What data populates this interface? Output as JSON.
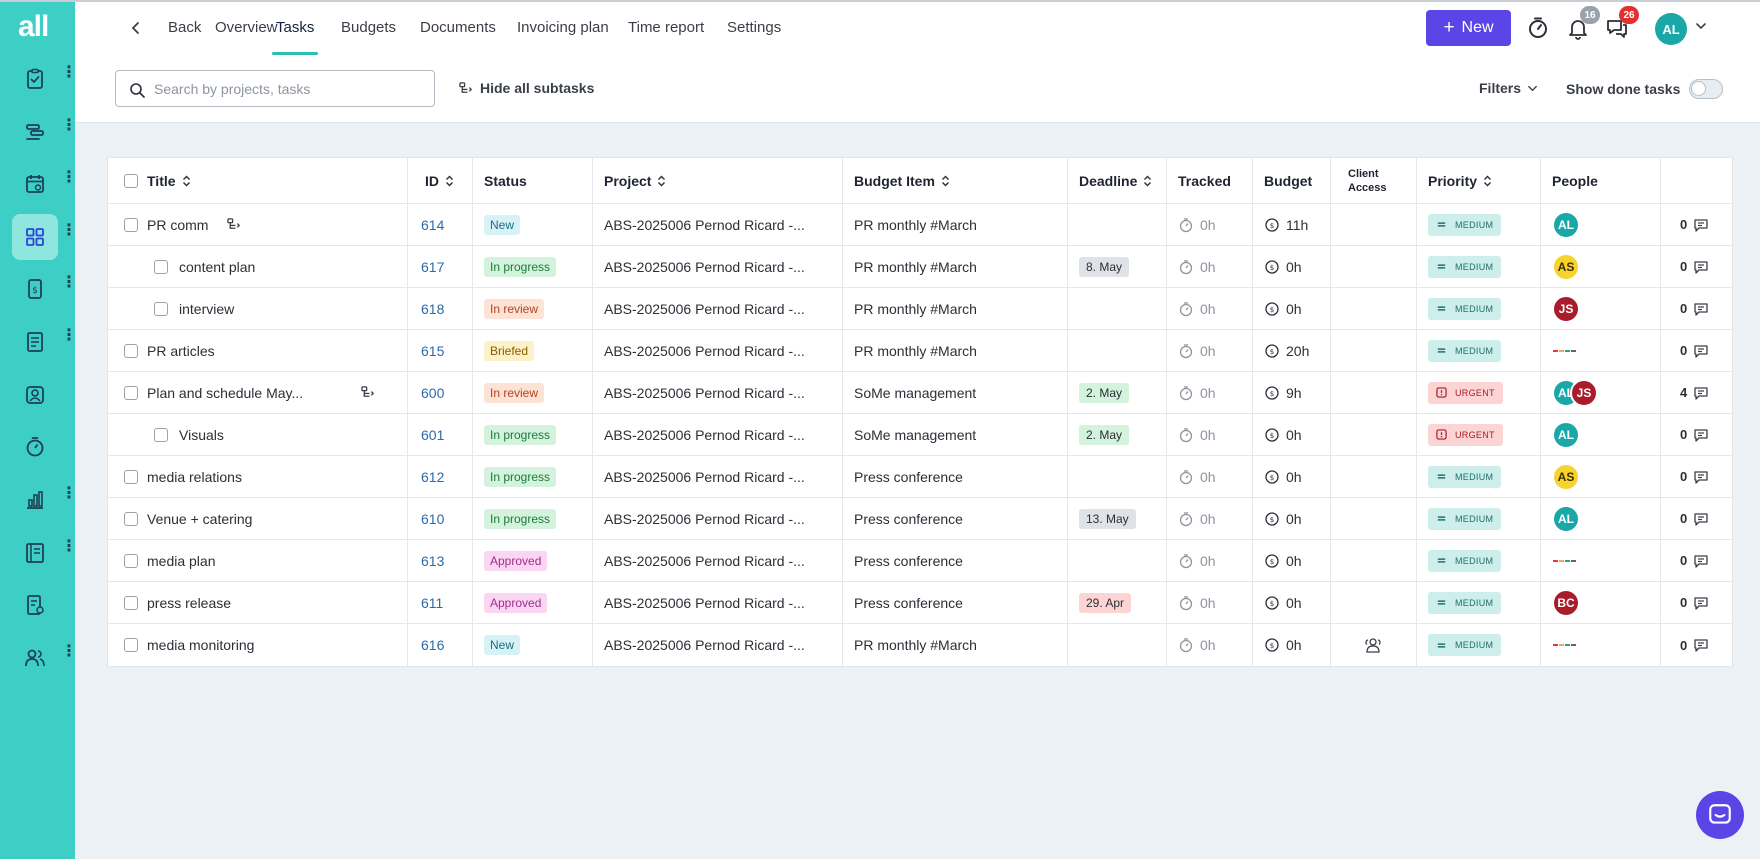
{
  "app": {
    "logo": "all"
  },
  "nav": {
    "back": "Back",
    "tabs": [
      "Overview",
      "Tasks",
      "Budgets",
      "Documents",
      "Invoicing plan",
      "Time report",
      "Settings"
    ],
    "active_tab": "Tasks",
    "new_label": "New",
    "notifications_count": "16",
    "messages_count": "26",
    "user_initials": "AL"
  },
  "toolbar": {
    "search_placeholder": "Search by projects, tasks",
    "hide_subtasks": "Hide all subtasks",
    "filters": "Filters",
    "show_done": "Show done tasks",
    "show_done_on": false
  },
  "table": {
    "headers": {
      "title": "Title",
      "id": "ID",
      "status": "Status",
      "project": "Project",
      "budget_item": "Budget Item",
      "deadline": "Deadline",
      "tracked": "Tracked",
      "budget": "Budget",
      "client_access": "Client Access",
      "priority": "Priority",
      "people": "People"
    },
    "rows": [
      {
        "title": "PR comm",
        "id": "614",
        "status": "New",
        "project": "ABS-2025006 Pernod Ricard -...",
        "budget_item": "PR monthly #March",
        "deadline": "",
        "tracked": "0h",
        "budget": "11h",
        "priority": "MEDIUM",
        "people": [
          "AL"
        ],
        "comments": "0"
      },
      {
        "title": "content plan",
        "id": "617",
        "status": "In progress",
        "project": "ABS-2025006 Pernod Ricard -...",
        "budget_item": "PR monthly #March",
        "deadline": "8. May",
        "tracked": "0h",
        "budget": "0h",
        "priority": "MEDIUM",
        "people": [
          "AS"
        ],
        "comments": "0"
      },
      {
        "title": "interview",
        "id": "618",
        "status": "In review",
        "project": "ABS-2025006 Pernod Ricard -...",
        "budget_item": "PR monthly #March",
        "deadline": "",
        "tracked": "0h",
        "budget": "0h",
        "priority": "MEDIUM",
        "people": [
          "JS"
        ],
        "comments": "0"
      },
      {
        "title": "PR articles",
        "id": "615",
        "status": "Briefed",
        "project": "ABS-2025006 Pernod Ricard -...",
        "budget_item": "PR monthly #March",
        "deadline": "",
        "tracked": "0h",
        "budget": "20h",
        "priority": "MEDIUM",
        "people": [],
        "comments": "0"
      },
      {
        "title": "Plan and schedule May...",
        "id": "600",
        "status": "In review",
        "project": "ABS-2025006 Pernod Ricard -...",
        "budget_item": "SoMe management",
        "deadline": "2. May",
        "tracked": "0h",
        "budget": "9h",
        "priority": "URGENT",
        "people": [
          "AL",
          "JS"
        ],
        "comments": "4"
      },
      {
        "title": "Visuals",
        "id": "601",
        "status": "In progress",
        "project": "ABS-2025006 Pernod Ricard -...",
        "budget_item": "SoMe management",
        "deadline": "2. May",
        "tracked": "0h",
        "budget": "0h",
        "priority": "URGENT",
        "people": [
          "AL"
        ],
        "comments": "0"
      },
      {
        "title": "media relations",
        "id": "612",
        "status": "In progress",
        "project": "ABS-2025006 Pernod Ricard -...",
        "budget_item": "Press conference",
        "deadline": "",
        "tracked": "0h",
        "budget": "0h",
        "priority": "MEDIUM",
        "people": [
          "AS"
        ],
        "comments": "0"
      },
      {
        "title": "Venue + catering",
        "id": "610",
        "status": "In progress",
        "project": "ABS-2025006 Pernod Ricard -...",
        "budget_item": "Press conference",
        "deadline": "13. May",
        "tracked": "0h",
        "budget": "0h",
        "priority": "MEDIUM",
        "people": [
          "AL"
        ],
        "comments": "0"
      },
      {
        "title": "media plan",
        "id": "613",
        "status": "Approved",
        "project": "ABS-2025006 Pernod Ricard -...",
        "budget_item": "Press conference",
        "deadline": "",
        "tracked": "0h",
        "budget": "0h",
        "priority": "MEDIUM",
        "people": [],
        "comments": "0"
      },
      {
        "title": "press release",
        "id": "611",
        "status": "Approved",
        "project": "ABS-2025006 Pernod Ricard -...",
        "budget_item": "Press conference",
        "deadline": "29. Apr",
        "tracked": "0h",
        "budget": "0h",
        "priority": "MEDIUM",
        "people": [
          "BC"
        ],
        "comments": "0"
      },
      {
        "title": "media monitoring",
        "id": "616",
        "status": "New",
        "project": "ABS-2025006 Pernod Ricard -...",
        "budget_item": "PR monthly #March",
        "deadline": "",
        "tracked": "0h",
        "budget": "0h",
        "priority": "MEDIUM",
        "people": [],
        "comments": "0"
      }
    ]
  },
  "colors": {
    "sidebar": "#3dcfc5",
    "accent": "#5b45e6",
    "status": {
      "New": [
        "#d6f2f6",
        "#1a6f80"
      ],
      "In progress": [
        "#d4f3dc",
        "#1d7a3a"
      ],
      "In review": [
        "#fde2d6",
        "#b0441e"
      ],
      "Briefed": [
        "#fdf1c8",
        "#8a5a00"
      ],
      "Approved": [
        "#fbd6f3",
        "#a02d8b"
      ]
    },
    "deadline": {
      "8. May": "#dfe3e8",
      "2. May": "#d4f3dc",
      "13. May": "#dfe3e8",
      "29. Apr": "#fcd4d4"
    },
    "people": {
      "AL": [
        "#1aa7a7",
        "#ffffff"
      ],
      "AS": [
        "#f6d32d",
        "#3a2f00"
      ],
      "JS": [
        "#a81c2b",
        "#ffffff"
      ],
      "BC": [
        "#a81c2b",
        "#ffffff"
      ]
    }
  }
}
